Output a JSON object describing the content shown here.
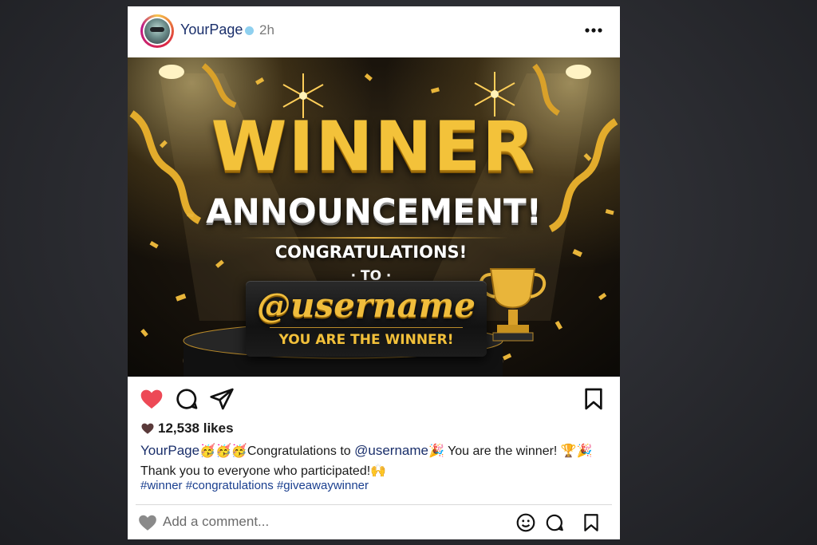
{
  "post": {
    "username": "YourPage",
    "time": "2h",
    "more_icon": "more-horizontal-icon",
    "image": {
      "headline": "WINNER",
      "subheadline": "ANNOUNCEMENT!",
      "congrats": "CONGRATULATIONS!",
      "to": "· TO ·",
      "handle": "@username",
      "winner_line": "YOU ARE THE WINNER!"
    },
    "likes": "12,538 likes",
    "caption": {
      "user": "YourPage",
      "emoji_1": "🥳🥳🥳",
      "text_1": "Congratulations to ",
      "mention": "@username",
      "emoji_2": "🎉",
      "text_2": " You are the winner! ",
      "emoji_3": "🏆🎉",
      "text_3": "Thank you to everyone who participated!",
      "emoji_4": "🙌"
    },
    "hashtags": "#winner #congratulations #giveawaywinner",
    "comment_placeholder": "Add a comment..."
  },
  "colors": {
    "like_red": "#ed4956",
    "link_blue": "#1a2f6b",
    "gold": "#f3c23a"
  }
}
